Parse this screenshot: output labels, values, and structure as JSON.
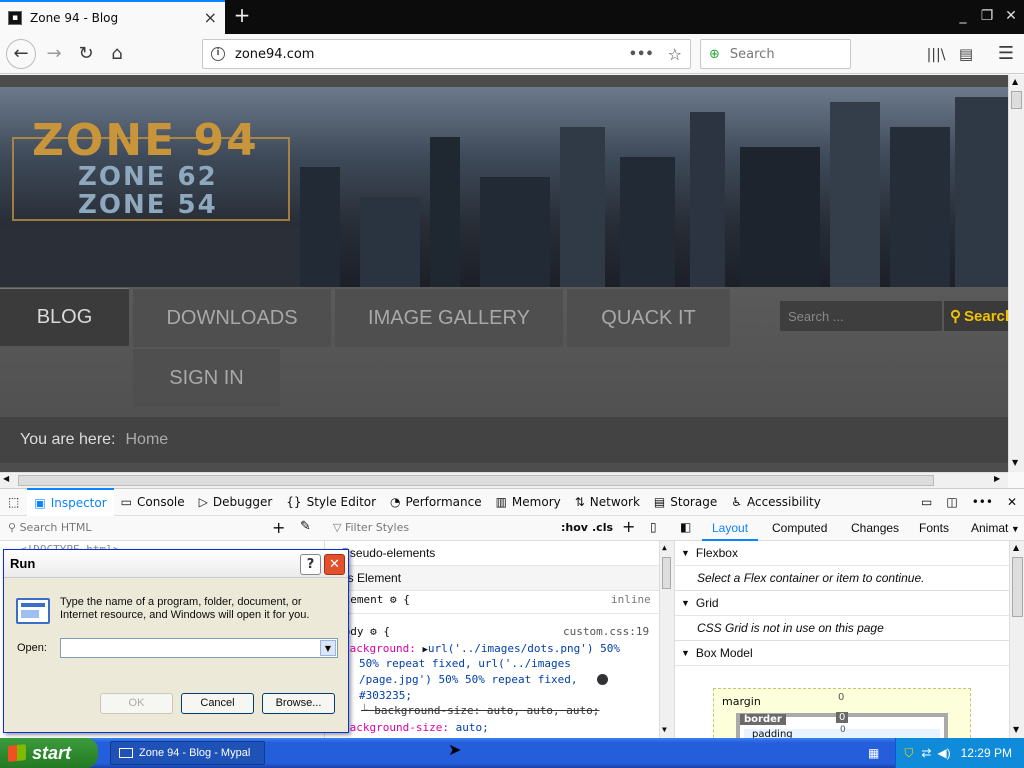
{
  "browser": {
    "tab_title": "Zone 94 - Blog",
    "tab_close": "×",
    "new_tab": "+",
    "url": "zone94.com",
    "url_more": "•••",
    "search_placeholder": "Search",
    "window_buttons": [
      "_",
      "❐",
      "✕"
    ]
  },
  "site": {
    "logo_main": "ZONE 94",
    "logo_sub1": "ZONE 62",
    "logo_sub2": "ZONE 54",
    "menu": [
      "BLOG",
      "DOWNLOADS",
      "IMAGE GALLERY",
      "QUACK IT",
      "SIGN IN"
    ],
    "active_menu": "BLOG",
    "search_placeholder": "Search ...",
    "search_button": "Search",
    "breadcrumb_label": "You are here:",
    "breadcrumb_value": "Home"
  },
  "devtools": {
    "tabs": [
      "Inspector",
      "Console",
      "Debugger",
      "Style Editor",
      "Performance",
      "Memory",
      "Network",
      "Storage",
      "Accessibility"
    ],
    "search_html_placeholder": "Search HTML",
    "filter_styles_placeholder": "Filter Styles",
    "hov": ":hov",
    "cls": ".cls",
    "layout_tabs": [
      "Layout",
      "Computed",
      "Changes",
      "Fonts",
      "Animat"
    ],
    "rules": {
      "pseudo": "Pseudo-elements",
      "this_element": "This Element",
      "element_line": "element",
      "inline": "inline",
      "body_selector": "body",
      "source": "custom.css:19",
      "bg_prop": "background:",
      "bg_val1": "url('../images/dots.png') 50%",
      "bg_val2": "50% repeat fixed, url('../images",
      "bg_val3": "/page.jpg') 50% 50% repeat fixed,",
      "bg_val4": "#303235;",
      "bg_size_sub": "background-size: auto, auto, auto;",
      "bg_size": "background-size:",
      "bg_size_val": "auto;"
    },
    "layout": {
      "flexbox": "Flexbox",
      "flexbox_msg": "Select a Flex container or item to continue.",
      "grid": "Grid",
      "grid_msg": "CSS Grid is not in use on this page",
      "box_model": "Box Model",
      "margin": "margin",
      "border": "border",
      "padding": "padding",
      "zero": "0"
    },
    "markup_line": "<!DOCTYPE html>"
  },
  "run_dialog": {
    "title": "Run",
    "help": "?",
    "close": "✕",
    "description": "Type the name of a program, folder, document, or Internet resource, and Windows will open it for you.",
    "open_label": "Open:",
    "open_value": "",
    "ok": "OK",
    "cancel": "Cancel",
    "browse": "Browse..."
  },
  "taskbar": {
    "start": "start",
    "task": "Zone 94 - Blog - Mypal",
    "clock": "12:29 PM"
  },
  "colors": {
    "accent": "#0a84ff",
    "xp_blue": "#245edb",
    "start_green": "#2f8a2f",
    "site_gold": "#c9953b",
    "search_yellow": "#f2c200"
  }
}
